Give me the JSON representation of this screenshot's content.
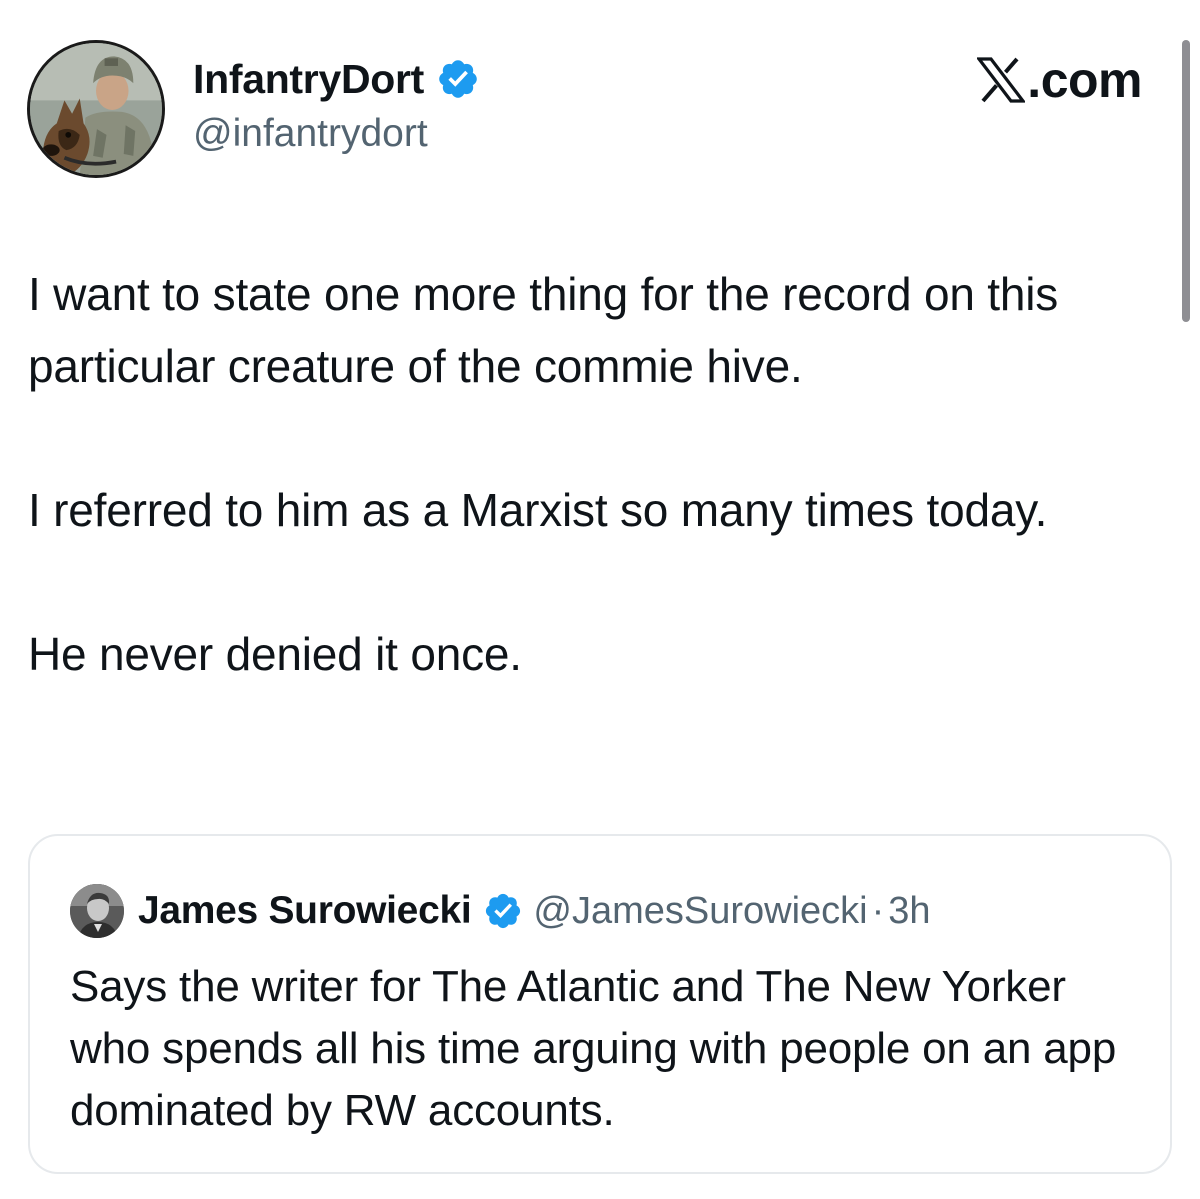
{
  "author": {
    "display_name": "InfantryDort",
    "handle": "@infantrydort",
    "verified": true,
    "avatar_icon": "soldier-with-dog-avatar"
  },
  "site": {
    "logo_icon": "x-logo-icon",
    "text": ".com"
  },
  "tweet": {
    "paragraphs": [
      "I want to state one more thing for the record on this particular creature of the commie hive.",
      "I referred to him as a Marxist so many times today.",
      "He never denied it once."
    ]
  },
  "quoted_tweet": {
    "display_name": "James Surowiecki",
    "handle": "@JamesSurowiecki",
    "separator": "·",
    "time": "3h",
    "verified": true,
    "avatar_icon": "person-avatar",
    "text": "Says the writer for The Atlantic and The New Yorker who spends all his time arguing with people on an app dominated by RW accounts."
  },
  "colors": {
    "verified_badge": "#1d9bf0",
    "secondary_text": "#536471",
    "primary_text": "#0f1419",
    "card_border": "#e6e9ec"
  }
}
